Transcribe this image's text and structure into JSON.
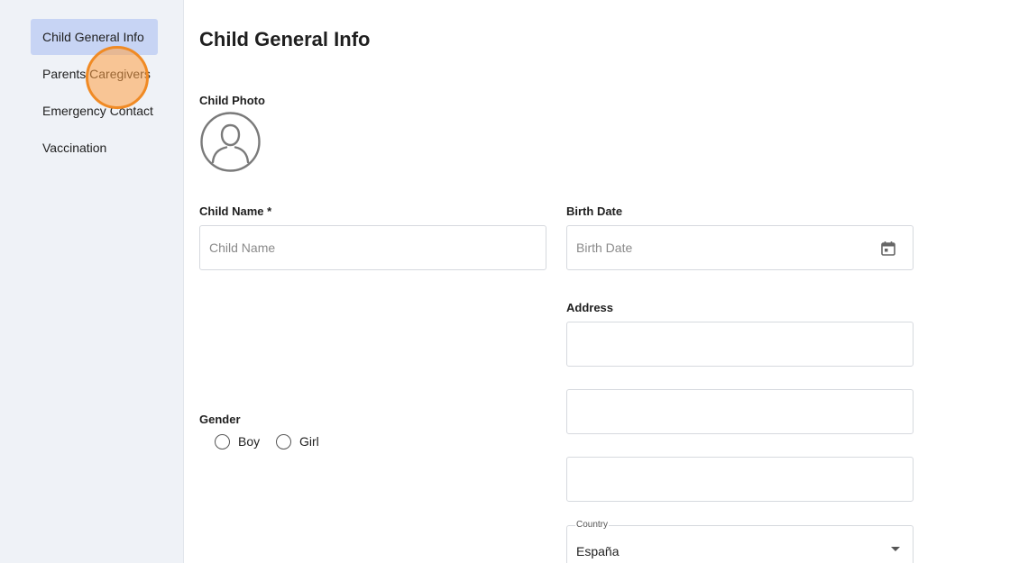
{
  "sidebar": {
    "items": [
      {
        "label": "Child General Info",
        "active": true
      },
      {
        "label": "Parents/Caregivers",
        "active": false
      },
      {
        "label": "Emergency Contact",
        "active": false
      },
      {
        "label": "Vaccination",
        "active": false
      }
    ]
  },
  "main": {
    "title": "Child General Info",
    "photo_label": "Child Photo",
    "avatar_icon": "user-avatar-icon",
    "child_name": {
      "label": "Child Name *",
      "placeholder": "Child Name",
      "value": ""
    },
    "birth_date": {
      "label": "Birth Date",
      "placeholder": "Birth Date",
      "value": "",
      "icon": "calendar-icon"
    },
    "address": {
      "label": "Address",
      "line1": "",
      "line2": "",
      "line3": ""
    },
    "gender": {
      "label": "Gender",
      "options": [
        "Boy",
        "Girl"
      ]
    },
    "country": {
      "label": "Country",
      "value": "España",
      "icon": "caret-down-icon"
    }
  },
  "colors": {
    "sidebar_bg": "#eff2f7",
    "active_item_bg": "#c7d4f4",
    "click_marker": "#f08a24"
  }
}
